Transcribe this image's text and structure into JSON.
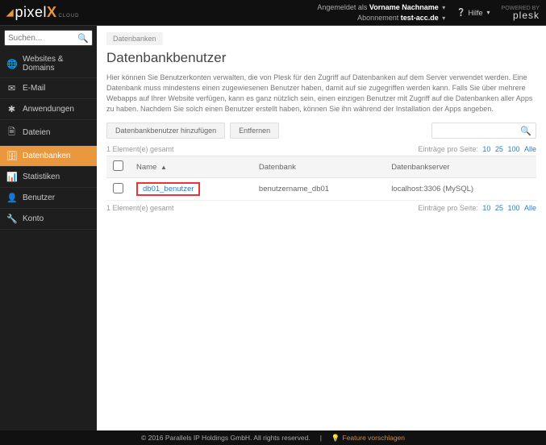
{
  "header": {
    "logo_pre": "pixel",
    "logo_post": "X",
    "logo_sub": "CLOUD",
    "auth_label": "Angemeldet als",
    "auth_name": "Vorname Nachname",
    "auth_sub_label": "Abonnement",
    "auth_account": "test-acc.de",
    "help": "Hilfe",
    "powered_label": "POWERED BY",
    "powered_brand": "plesk"
  },
  "search": {
    "placeholder": "Suchen..."
  },
  "nav": {
    "items": [
      {
        "icon": "🌐",
        "label": "Websites & Domains"
      },
      {
        "icon": "✉",
        "label": "E-Mail"
      },
      {
        "icon": "✱",
        "label": "Anwendungen"
      },
      {
        "icon": "🗎",
        "label": "Dateien"
      },
      {
        "icon": "🗄",
        "label": "Datenbanken"
      },
      {
        "icon": "📊",
        "label": "Statistiken"
      },
      {
        "icon": "👤",
        "label": "Benutzer"
      },
      {
        "icon": "🔧",
        "label": "Konto"
      }
    ],
    "active_index": 4
  },
  "breadcrumb": "Datenbanken",
  "page_title": "Datenbankbenutzer",
  "description": "Hier können Sie Benutzerkonten verwalten, die von Plesk für den Zugriff auf Datenbanken auf dem Server verwendet werden. Eine Datenbank muss mindestens einen zugewiesenen Benutzer haben, damit auf sie zugegriffen werden kann. Falls Sie über mehrere Webapps auf Ihrer Website verfügen, kann es ganz nützlich sein, einen einzigen Benutzer mit Zugriff auf die Datenbanken aller Apps zu haben. Nachdem Sie solch einen Benutzer erstellt haben, können Sie ihn während der Installation der Apps angeben.",
  "toolbar": {
    "add": "Datenbankbenutzer hinzufügen",
    "remove": "Entfernen"
  },
  "list": {
    "count_text_top": "1 Element(e) gesamt",
    "count_text_bottom": "1 Element(e) gesamt",
    "per_page_label": "Einträge pro Seite:",
    "per_page_options": [
      "10",
      "25",
      "100",
      "Alle"
    ],
    "columns": {
      "name": "Name",
      "db": "Datenbank",
      "server": "Datenbankserver"
    },
    "rows": [
      {
        "name": "db01_benutzer",
        "db": "benutzername_db01",
        "server": "localhost:3306 (MySQL)"
      }
    ]
  },
  "footer": {
    "copyright": "© 2016 Parallels IP Holdings GmbH. All rights reserved.",
    "feature": "Feature vorschlagen"
  }
}
